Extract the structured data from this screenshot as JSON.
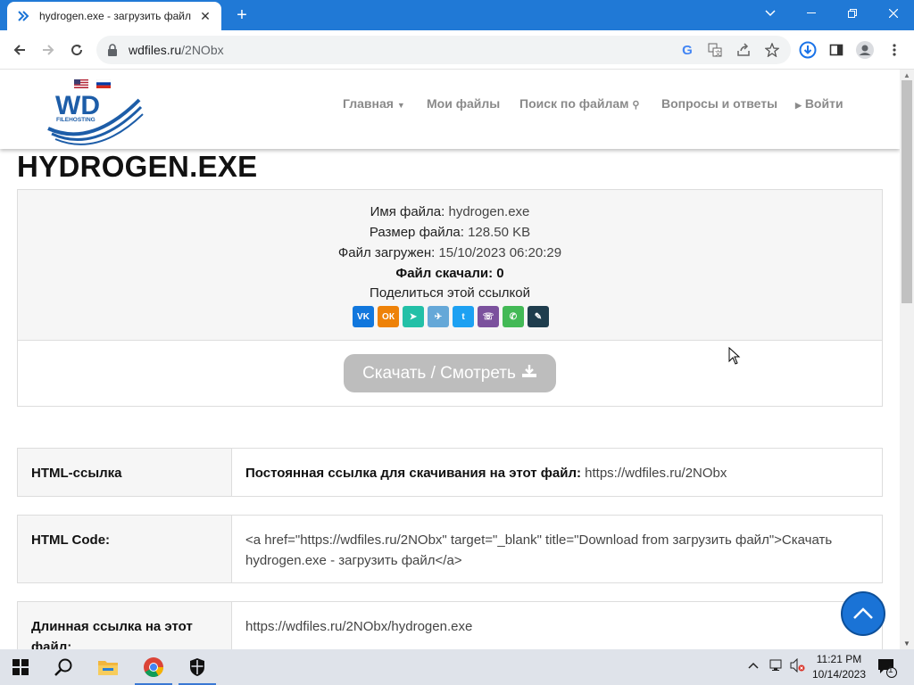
{
  "browser": {
    "tab_title": "hydrogen.exe - загрузить файл",
    "url_domain": "wdfiles.ru",
    "url_path": "/2NObx"
  },
  "site": {
    "logo_text": "WD",
    "logo_subtext": "FILEHOSTING",
    "menu": {
      "home": "Главная",
      "my_files": "Мои файлы",
      "search": "Поиск по файлам",
      "faq": "Вопросы и ответы",
      "login": "Войти"
    }
  },
  "page": {
    "title": "HYDROGEN.EXE",
    "file_name_label": "Имя файла:",
    "file_name": "hydrogen.exe",
    "file_size_label": "Размер файла:",
    "file_size": "128.50 KB",
    "uploaded_label": "Файл загружен:",
    "uploaded": "15/10/2023 06:20:29",
    "downloads_label": "Файл скачали:",
    "downloads": "0",
    "share_label": "Поделиться этой ссылкой",
    "share_icons": [
      "vk-icon",
      "odnoklassniki-icon",
      "send-icon",
      "telegram-icon",
      "twitter-icon",
      "viber-icon",
      "whatsapp-icon",
      "edit-icon"
    ],
    "download_button": "Скачать / Смотреть"
  },
  "links": [
    {
      "label": "HTML-ссылка",
      "bold_text": "Постоянная ссылка для скачивания на этот файл:",
      "value": "https://wdfiles.ru/2NObx"
    },
    {
      "label": "HTML Code:",
      "value": "<a href=\"https://wdfiles.ru/2NObx\" target=\"_blank\" title=\"Download from загрузить файл\">Скачать hydrogen.exe - загрузить файл</a>"
    },
    {
      "label": "Длинная ссылка на этот файл:",
      "value": "https://wdfiles.ru/2NObx/hydrogen.exe"
    }
  ],
  "taskbar": {
    "time": "11:21 PM",
    "date": "10/14/2023",
    "notification_count": "1"
  },
  "colors": {
    "chrome_blue": "#2079d6",
    "button_disabled": "#bdbdbd",
    "to_top": "#1a73d6"
  }
}
